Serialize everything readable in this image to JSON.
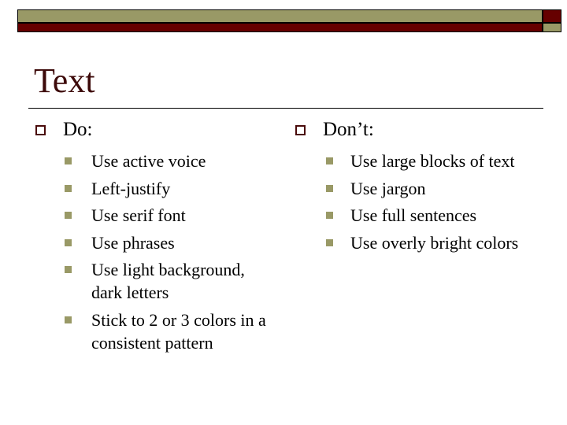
{
  "slide": {
    "title": "Text",
    "colors": {
      "title": "#3d0a0a",
      "bar_olive": "#999966",
      "bar_red": "#660000",
      "hollow_bullet": "#4a0a0a",
      "filled_bullet": "#999966"
    },
    "columns": [
      {
        "heading": "Do:",
        "items": [
          "Use active voice",
          "Left-justify",
          "Use serif font",
          "Use phrases",
          "Use light background, dark letters",
          "Stick to 2 or 3 colors in a consistent pattern"
        ]
      },
      {
        "heading": "Don’t:",
        "items": [
          "Use large blocks of text",
          "Use jargon",
          "Use full sentences",
          "Use overly bright colors"
        ]
      }
    ],
    "bullet_icons": {
      "level1": "hollow-square-icon",
      "level2": "filled-square-icon"
    }
  }
}
